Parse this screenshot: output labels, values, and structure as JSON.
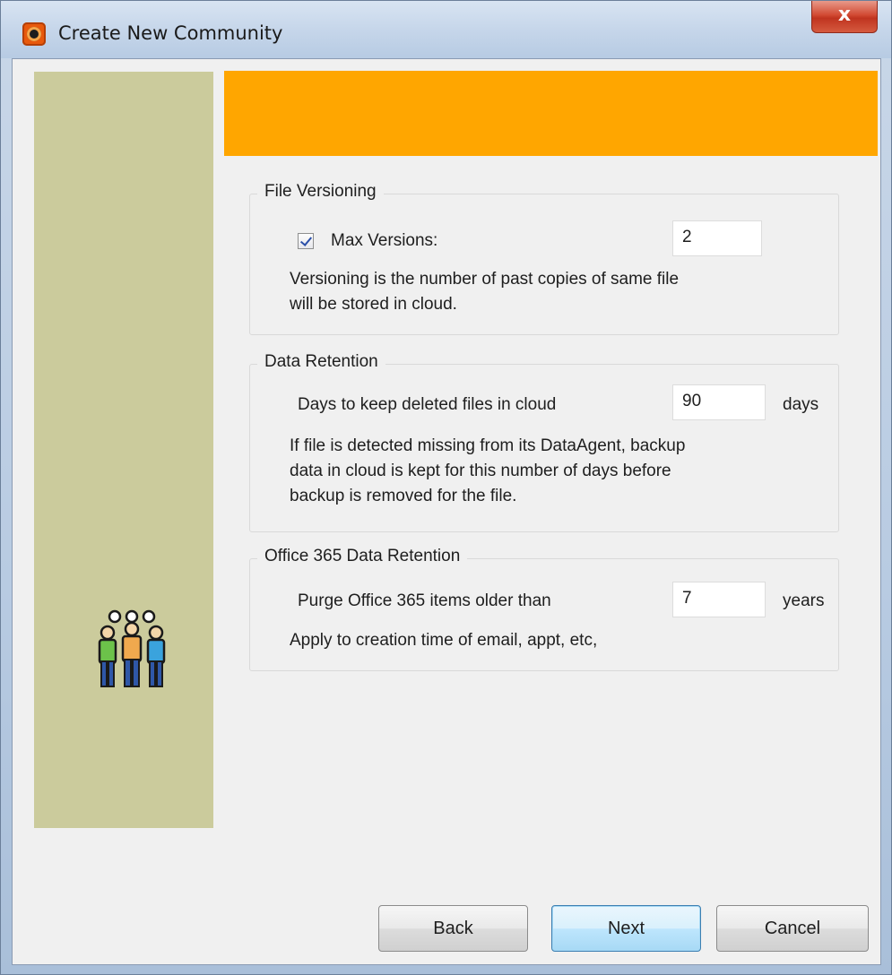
{
  "window": {
    "title": "Create New Community",
    "close_label": "x",
    "accent_color": "#ffa600",
    "side_panel_color": "#cbcb9c"
  },
  "side_panel": {
    "icon": "people-group-icon"
  },
  "file_versioning": {
    "title": "File Versioning",
    "max_versions_label": "Max Versions:",
    "max_versions_checked": true,
    "max_versions_value": "2",
    "description_line1": "Versioning is the number of past copies of same file",
    "description_line2": "will be stored in cloud."
  },
  "data_retention": {
    "title": "Data Retention",
    "days_label": "Days to keep deleted files in cloud",
    "days_value": "90",
    "days_unit": "days",
    "description_line1": "If file is detected missing from its DataAgent, backup",
    "description_line2": "data in cloud is kept for this number of days before",
    "description_line3": "backup is removed for the file."
  },
  "office365": {
    "title": "Office 365 Data Retention",
    "purge_label": "Purge Office 365 items older than",
    "purge_value": "7",
    "purge_unit": "years",
    "description": "Apply to creation time of email, appt, etc,"
  },
  "buttons": {
    "back": "Back",
    "next": "Next",
    "cancel": "Cancel"
  }
}
